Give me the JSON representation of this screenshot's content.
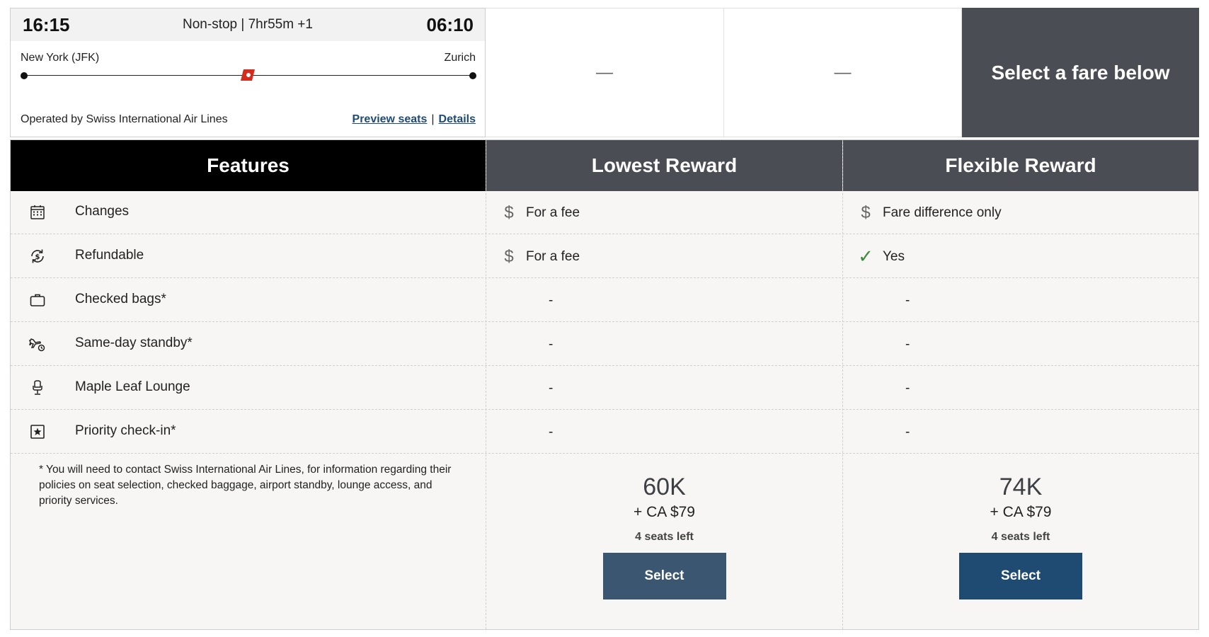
{
  "flight": {
    "departure_time": "16:15",
    "arrival_time": "06:10",
    "duration": "Non-stop | 7hr55m +1",
    "origin": "New York (JFK)",
    "destination": "Zurich",
    "airline_icon": "swiss-tail-icon",
    "operated_by": "Operated by Swiss International Air Lines",
    "preview_seats_link": "Preview seats",
    "link_separator": "|",
    "details_link": "Details"
  },
  "fare_columns": {
    "empty_1": "—",
    "empty_2": "—",
    "select_prompt": "Select a fare below"
  },
  "table": {
    "headers": {
      "features": "Features",
      "lowest": "Lowest Reward",
      "flexible": "Flexible Reward"
    },
    "rows": [
      {
        "icon": "calendar-icon",
        "label": "Changes",
        "lowest": "For a fee",
        "lowest_icon": "dollar-icon",
        "flexible": "Fare difference only",
        "flexible_icon": "dollar-icon"
      },
      {
        "icon": "refund-icon",
        "label": "Refundable",
        "lowest": "For a fee",
        "lowest_icon": "dollar-icon",
        "flexible": "Yes",
        "flexible_icon": "check-icon"
      },
      {
        "icon": "suitcase-icon",
        "label": "Checked bags*",
        "lowest": "-",
        "flexible": "-"
      },
      {
        "icon": "plane-clock-icon",
        "label": "Same-day standby*",
        "lowest": "-",
        "flexible": "-"
      },
      {
        "icon": "lounge-icon",
        "label": "Maple Leaf Lounge",
        "lowest": "-",
        "flexible": "-"
      },
      {
        "icon": "star-box-icon",
        "label": "Priority check-in*",
        "lowest": "-",
        "flexible": "-"
      }
    ],
    "footnote": "* You will need to contact Swiss International Air Lines, for information regarding their policies on seat selection, checked baggage, airport standby, lounge access, and priority services."
  },
  "fares": {
    "lowest": {
      "points": "60K",
      "cash": "+ CA $79",
      "seats": "4 seats left",
      "button": "Select"
    },
    "flexible": {
      "points": "74K",
      "cash": "+ CA $79",
      "seats": "4 seats left",
      "button": "Select"
    }
  },
  "colors": {
    "header_dark": "#4a4d54",
    "features_header": "#000000",
    "link": "#1e4b78",
    "select_lowest": "#3b5670",
    "select_flexible": "#1f4a72",
    "check": "#3e8a3e"
  }
}
